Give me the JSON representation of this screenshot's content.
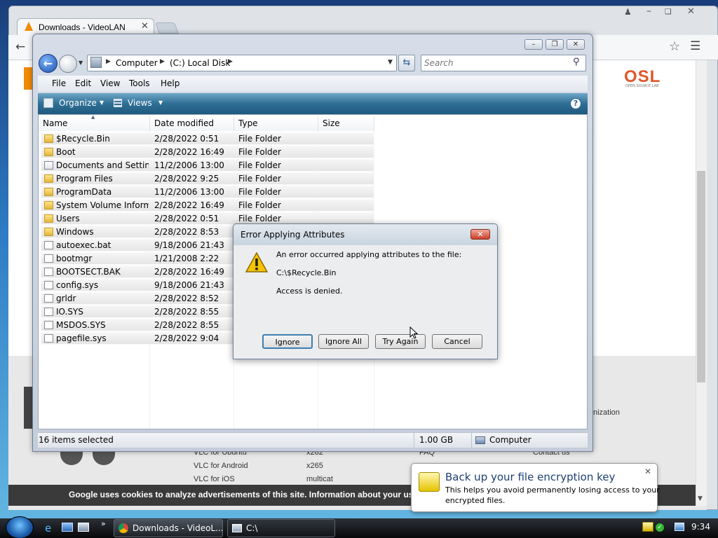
{
  "browser": {
    "tab_title": "Downloads - VideoLAN",
    "osl_logo": "OSL",
    "osl_sub": "OPEN SOURCE LAB",
    "cookie_text": "Google uses cookies to analyze advertisements of this site. Information about your use",
    "footer": {
      "col1": [
        "VLC for Ubuntu",
        "VLC for Android",
        "VLC for iOS"
      ],
      "col2": [
        "x262",
        "x265",
        "multicat"
      ],
      "col3": "FAQ",
      "col4": "Contact us",
      "partial": "nization"
    }
  },
  "explorer": {
    "breadcrumb": [
      "Computer",
      "(C:) Local Disk"
    ],
    "search_placeholder": "Search",
    "menu": [
      "File",
      "Edit",
      "View",
      "Tools",
      "Help"
    ],
    "commands": {
      "organize": "Organize",
      "views": "Views"
    },
    "columns": [
      "Name",
      "Date modified",
      "Type",
      "Size"
    ],
    "files": [
      {
        "name": "$Recycle.Bin",
        "date": "2/28/2022 0:51",
        "type": "File Folder",
        "icon": "folder"
      },
      {
        "name": "Boot",
        "date": "2/28/2022 16:49",
        "type": "File Folder",
        "icon": "folder"
      },
      {
        "name": "Documents and Settings",
        "date": "11/2/2006 13:00",
        "type": "File Folder",
        "icon": "shortcut"
      },
      {
        "name": "Program Files",
        "date": "2/28/2022 9:25",
        "type": "File Folder",
        "icon": "folder"
      },
      {
        "name": "ProgramData",
        "date": "11/2/2006 13:00",
        "type": "File Folder",
        "icon": "folder"
      },
      {
        "name": "System Volume Inform...",
        "date": "2/28/2022 16:49",
        "type": "File Folder",
        "icon": "folder"
      },
      {
        "name": "Users",
        "date": "2/28/2022 0:51",
        "type": "File Folder",
        "icon": "folder"
      },
      {
        "name": "Windows",
        "date": "2/28/2022 8:53",
        "type": "",
        "icon": "folder"
      },
      {
        "name": "autoexec.bat",
        "date": "9/18/2006 21:43",
        "type": "",
        "icon": "doc"
      },
      {
        "name": "bootmgr",
        "date": "1/21/2008 2:22",
        "type": "",
        "icon": "doc"
      },
      {
        "name": "BOOTSECT.BAK",
        "date": "2/28/2022 16:49",
        "type": "",
        "icon": "doc"
      },
      {
        "name": "config.sys",
        "date": "9/18/2006 21:43",
        "type": "",
        "icon": "doc"
      },
      {
        "name": "grldr",
        "date": "2/28/2022 8:52",
        "type": "",
        "icon": "doc"
      },
      {
        "name": "IO.SYS",
        "date": "2/28/2022 8:55",
        "type": "",
        "icon": "doc"
      },
      {
        "name": "MSDOS.SYS",
        "date": "2/28/2022 8:55",
        "type": "",
        "icon": "doc"
      },
      {
        "name": "pagefile.sys",
        "date": "2/28/2022 9:04",
        "type": "",
        "icon": "doc"
      }
    ],
    "status": {
      "selected": "16 items selected",
      "size": "1.00 GB",
      "location": "Computer"
    }
  },
  "dialog": {
    "title": "Error Applying Attributes",
    "message": "An error occurred applying attributes to the file:",
    "path": "C:\\$Recycle.Bin",
    "detail": "Access is denied.",
    "buttons": {
      "ignore": "Ignore",
      "ignore_all": "Ignore All",
      "try_again": "Try Again",
      "cancel": "Cancel"
    }
  },
  "notification": {
    "title": "Back up your file encryption key",
    "body_line1": "This helps you avoid permanently losing access to your",
    "body_line2": "encrypted files."
  },
  "taskbar": {
    "items": [
      "Downloads - VideoL...",
      "C:\\"
    ],
    "clock": "9:34"
  }
}
